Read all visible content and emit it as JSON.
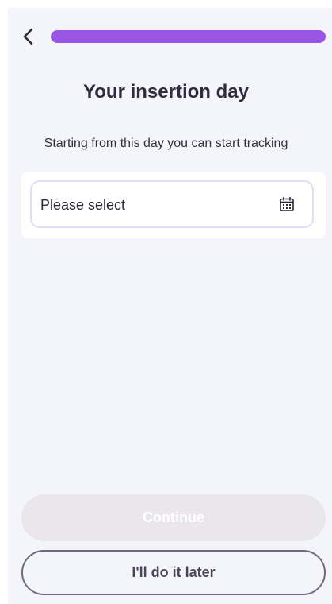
{
  "header": {
    "back_icon": "chevron-left-icon",
    "progress_fraction": 1.0,
    "progress_color": "#9a55e4"
  },
  "main": {
    "title": "Your insertion day",
    "subtitle": "Starting from this day you can start tracking",
    "date_field": {
      "placeholder": "Please select",
      "icon": "calendar-icon"
    }
  },
  "footer": {
    "continue_label": "Continue",
    "continue_state": "disabled",
    "later_label": "I'll do it later"
  }
}
